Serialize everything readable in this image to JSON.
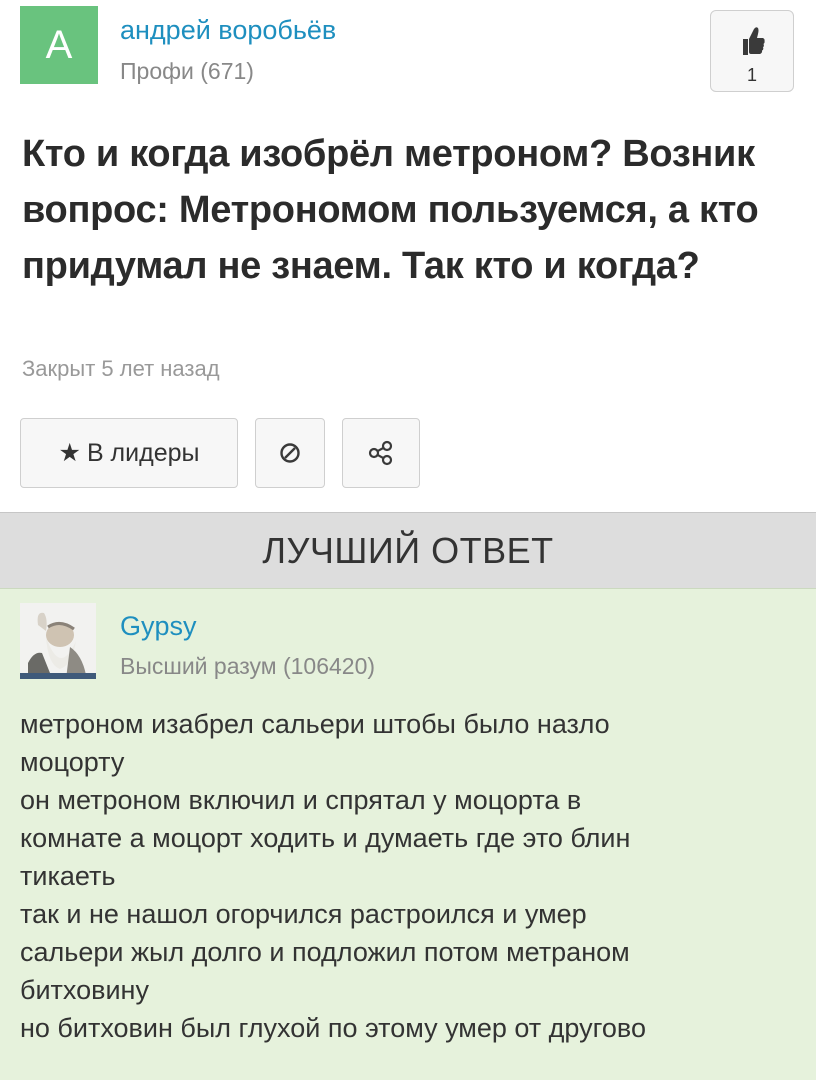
{
  "question": {
    "author": {
      "avatar_letter": "А",
      "name": "андрей воробьёв",
      "rank": "Профи (671)"
    },
    "like_count": "1",
    "title": "Кто и когда изобрёл метроном? Возник вопрос: Метрономом пользуемся, а кто придумал не знаем. Так кто и когда?",
    "status": "Закрыт 5 лет назад",
    "actions": {
      "leaders_star": "★",
      "leaders_label": "В лидеры"
    }
  },
  "best_answer": {
    "header": "ЛУЧШИЙ ОТВЕТ",
    "author": {
      "name": "Gypsy",
      "rank": "Высший разум (106420)"
    },
    "lines": [
      "метроном изабрел сальери штобы было назло",
      "моцорту",
      "он метроном включил и спрятал у моцорта в",
      "комнате а моцорт ходить и думаеть где это блин",
      "тикаеть",
      "так и не нашол огорчился растроился и умер",
      "сальери жыл долго и подложил потом метраном",
      "битховину",
      "но битховин был глухой по этому умер от другово"
    ]
  },
  "colors": {
    "avatar_green": "#69c37e",
    "link_blue": "#1e8fbf",
    "best_answer_bg": "#e6f2dc",
    "header_bg": "#dddddd"
  },
  "icons": [
    "thumbs-up-icon",
    "star-icon",
    "block-icon",
    "share-icon"
  ]
}
